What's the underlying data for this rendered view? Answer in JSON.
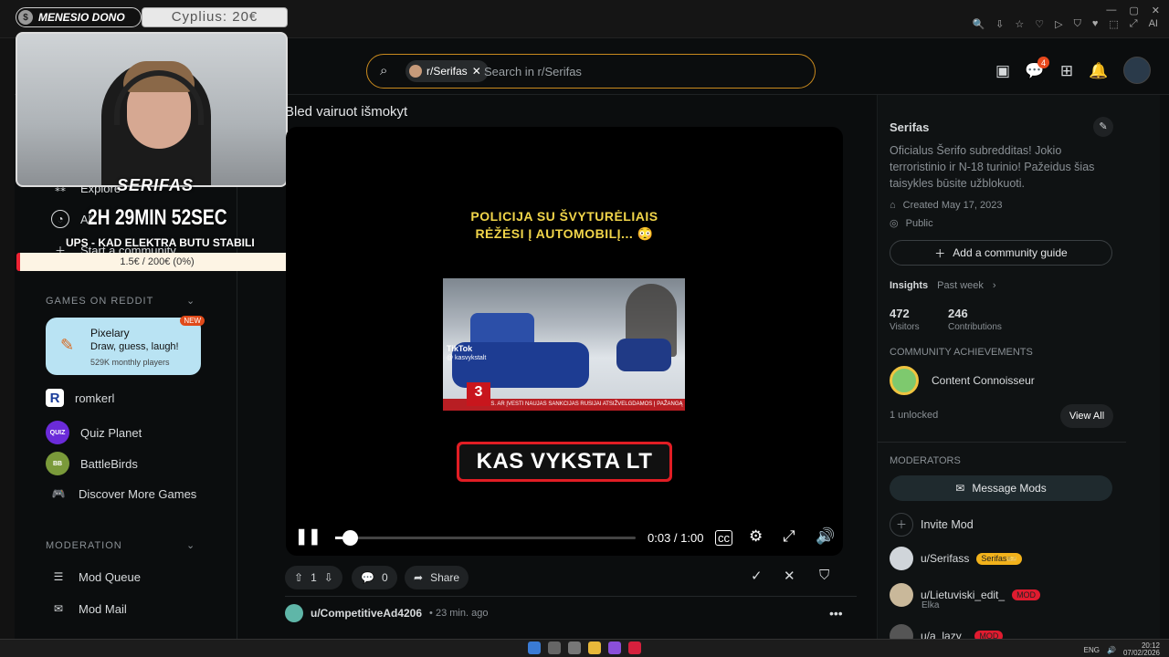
{
  "browser": {
    "right_icons": [
      "🔍",
      "⇩",
      "☆",
      "♡",
      "▷",
      "⛉",
      "♥",
      "⬚",
      "⤢",
      "AI"
    ],
    "window_controls": [
      "—",
      "▢",
      "✕"
    ]
  },
  "topbar": {
    "search_chip": "r/Serifas",
    "search_placeholder": "Search in r/Serifas",
    "notif_count": "4"
  },
  "overlay": {
    "dono_label": "MENESIO DONO",
    "dono_coin": "$",
    "donor_text": "Cyplius: 20€",
    "streamer": "SERIFAS",
    "timer": "2H 29MIN 52SEC",
    "goal_title": "UPS - KAD ELEKTRA BUTU STABILI",
    "goal_progress": "1.5€ / 200€ (0%)",
    "goal_fraction": 0.0075
  },
  "sidebar": {
    "items": [
      {
        "label": "Explore",
        "icon": "explore-icon"
      },
      {
        "label": "All",
        "icon": "all-icon"
      },
      {
        "label": "Start a community",
        "icon": "plus-icon"
      }
    ],
    "games_header": "GAMES ON REDDIT",
    "featured": {
      "title": "Pixelary",
      "subtitle": "Draw, guess, laugh!",
      "meta": "529K monthly players",
      "badge": "NEW"
    },
    "games": [
      {
        "label": "romkerl",
        "icon": "R"
      },
      {
        "label": "Quiz Planet",
        "icon": "QUIZ"
      },
      {
        "label": "BattleBirds",
        "icon": "BB"
      },
      {
        "label": "Discover More Games",
        "icon": "🎮"
      }
    ],
    "moderation_header": "MODERATION",
    "moderation": [
      {
        "label": "Mod Queue",
        "icon": "☰"
      },
      {
        "label": "Mod Mail",
        "icon": "✉"
      }
    ]
  },
  "post": {
    "title": "Bled vairuot išmokyt",
    "video_caption_line1": "POLICIJA SU ŠVYTURĖLIAIS",
    "video_caption_line2": "RĖŽĖSI Į AUTOMOBILĮ... 😳",
    "tiktok": "TikTok",
    "tiktok_handle": "@ kasvykstalt",
    "news_logo": "3",
    "news_ticker": "RES. AR ĮVESTI NAUJAS SANKCIJAS RUSIJAI ATSIŽVELGDAMOS Į PAŽANGĄ",
    "banner": "KAS VYKSTA LT",
    "time": "0:03 / 1:00",
    "progress_fraction": 0.05,
    "votes": "1",
    "comments": "0",
    "share": "Share"
  },
  "next_post": {
    "user": "u/CompetitiveAd4206",
    "ago": "• 23 min. ago"
  },
  "community": {
    "name": "Serifas",
    "description": "Oficialus Šerifo subredditas! Jokio terroristinio ir N-18 turinio! Pažeidus šias taisykles būsite užblokuoti.",
    "created": "Created May 17, 2023",
    "visibility": "Public",
    "guide_button": "Add a community guide",
    "insights_label": "Insights",
    "insights_range": "Past week",
    "visitors": "472",
    "visitors_label": "Visitors",
    "contributions": "246",
    "contributions_label": "Contributions",
    "achievements_header": "COMMUNITY ACHIEVEMENTS",
    "achievement": "Content Connoisseur",
    "unlocked": "1 unlocked",
    "view_all": "View All",
    "moderators_header": "MODERATORS",
    "message_mods": "Message Mods",
    "invite_mod": "Invite Mod",
    "mods": [
      {
        "name": "u/Serifass",
        "flair": "Serifas🎫"
      },
      {
        "name": "u/Lietuviski_edit_",
        "flair": "MOD",
        "sub": "Elka"
      },
      {
        "name": "u/a_lazy_",
        "flair": "MOD"
      }
    ]
  },
  "taskbar": {
    "tray": [
      "ENG",
      "🔊",
      "20:12",
      "07/02/2026"
    ]
  }
}
